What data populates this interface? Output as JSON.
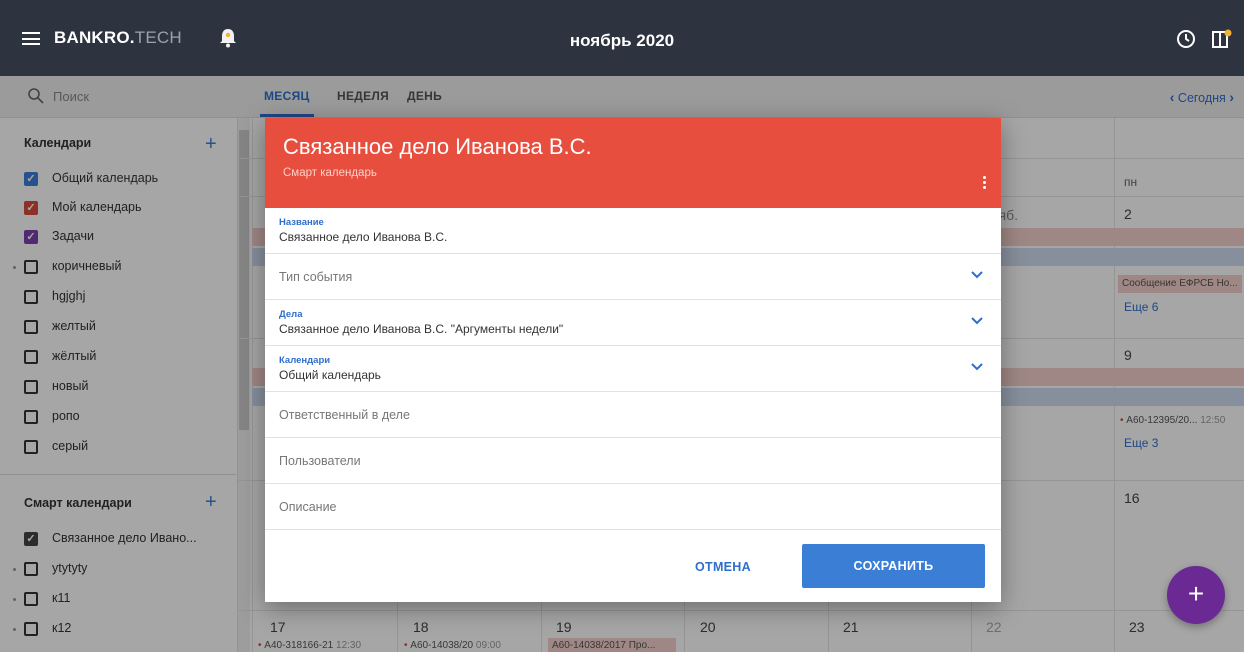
{
  "topbar": {
    "brand_main": "BANKRO.",
    "brand_suffix": "TECH",
    "month_title": "ноябрь 2020"
  },
  "sidebar": {
    "search_placeholder": "Поиск",
    "calendars_title": "Календари",
    "add_symbol": "+",
    "calendars": [
      {
        "label": "Общий календарь",
        "checked": true,
        "color": "#3d7fd9"
      },
      {
        "label": "Мой календарь",
        "checked": true,
        "color": "#d94b3d"
      },
      {
        "label": "Задачи",
        "checked": true,
        "color": "#7b3fb0"
      },
      {
        "label": "коричневый",
        "checked": false
      },
      {
        "label": "hgjghj",
        "checked": false
      },
      {
        "label": "желтый",
        "checked": false
      },
      {
        "label": "жёлтый",
        "checked": false
      },
      {
        "label": "новый",
        "checked": false
      },
      {
        "label": "ропо",
        "checked": false
      },
      {
        "label": "серый",
        "checked": false
      }
    ],
    "smart_title": "Смарт календари",
    "smart_calendars": [
      {
        "label": "Связанное дело Ивано...",
        "checked": true,
        "color": "#444444"
      },
      {
        "label": "ytytyty",
        "checked": false
      },
      {
        "label": "к11",
        "checked": false
      },
      {
        "label": "к12",
        "checked": false
      }
    ]
  },
  "view": {
    "tabs": [
      "МЕСЯЦ",
      "НЕДЕЛЯ",
      "ДЕНЬ"
    ],
    "today_label": "Сегодня"
  },
  "grid": {
    "weekday_mon": "пн",
    "date_nov": "нояб.",
    "day_2": "2",
    "day_9": "9",
    "day_16": "16",
    "day_17": "17",
    "day_18": "18",
    "day_19": "19",
    "day_20": "20",
    "day_21": "21",
    "day_22": "22",
    "day_23": "23",
    "efrsb_chip": "Сообщение ЕФРСБ Но...",
    "more_6": "Еще 6",
    "more_3": "Еще 3",
    "a60_chip": "А60-12395/20...",
    "a60_time": "12:50",
    "a40_chip": "А40-318166-21",
    "a40_time": "12:30",
    "a60b_chip": "А60-14038/20",
    "a60b_time": "09:00",
    "a60c_chip": "А60-14038/2017 Про..."
  },
  "dialog": {
    "title": "Связанное дело Иванова В.С.",
    "subtitle": "Смарт календарь",
    "name_label": "Название",
    "name_value": "Связанное дело Иванова В.С.",
    "event_type_placeholder": "Тип события",
    "cases_label": "Дела",
    "cases_value": "Связанное дело Иванова В.С. \"Аргументы недели\"",
    "calendars_label": "Календари",
    "calendars_value": "Общий календарь",
    "responsible_placeholder": "Ответственный в деле",
    "users_placeholder": "Пользователи",
    "description_placeholder": "Описание",
    "cancel_label": "ОТМЕНА",
    "save_label": "СОХРАНИТЬ",
    "header_color": "#e84e3e"
  },
  "fab_label": "+"
}
